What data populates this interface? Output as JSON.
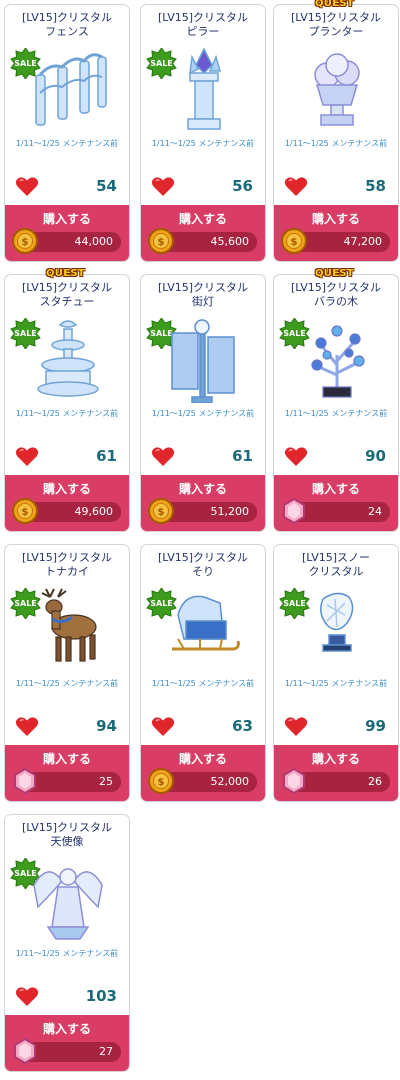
{
  "period_text": "1/11～1/25 メンテナンス前",
  "buy_label": "購入する",
  "sale_badge": "SALE",
  "quest_badge": "QUEST",
  "items": [
    {
      "name1": "[LV15]クリスタル",
      "name2": "フェンス",
      "likes": "54",
      "price": "44,000",
      "currency": "coin",
      "sale": true,
      "quest": false,
      "art": "fence"
    },
    {
      "name1": "[LV15]クリスタル",
      "name2": "ピラー",
      "likes": "56",
      "price": "45,600",
      "currency": "coin",
      "sale": true,
      "quest": false,
      "art": "pillar"
    },
    {
      "name1": "[LV15]クリスタル",
      "name2": "プランター",
      "likes": "58",
      "price": "47,200",
      "currency": "coin",
      "sale": false,
      "quest": true,
      "art": "planter"
    },
    {
      "name1": "[LV15]クリスタル",
      "name2": "スタチュー",
      "likes": "61",
      "price": "49,600",
      "currency": "coin",
      "sale": true,
      "quest": true,
      "art": "fountain"
    },
    {
      "name1": "[LV15]クリスタル",
      "name2": "街灯",
      "likes": "61",
      "price": "51,200",
      "currency": "coin",
      "sale": true,
      "quest": false,
      "art": "lamp"
    },
    {
      "name1": "[LV15]クリスタル",
      "name2": "バラの木",
      "likes": "90",
      "price": "24",
      "currency": "gem",
      "sale": true,
      "quest": true,
      "art": "rosetree"
    },
    {
      "name1": "[LV15]クリスタル",
      "name2": "トナカイ",
      "likes": "94",
      "price": "25",
      "currency": "gem",
      "sale": true,
      "quest": false,
      "art": "reindeer"
    },
    {
      "name1": "[LV15]クリスタル",
      "name2": "そり",
      "likes": "63",
      "price": "52,000",
      "currency": "coin",
      "sale": true,
      "quest": false,
      "art": "sleigh"
    },
    {
      "name1": "[LV15]スノー",
      "name2": "クリスタル",
      "likes": "99",
      "price": "26",
      "currency": "gem",
      "sale": true,
      "quest": false,
      "art": "snowcrystal"
    },
    {
      "name1": "[LV15]クリスタル",
      "name2": "天使像",
      "likes": "103",
      "price": "27",
      "currency": "gem",
      "sale": true,
      "quest": false,
      "art": "angel"
    }
  ]
}
